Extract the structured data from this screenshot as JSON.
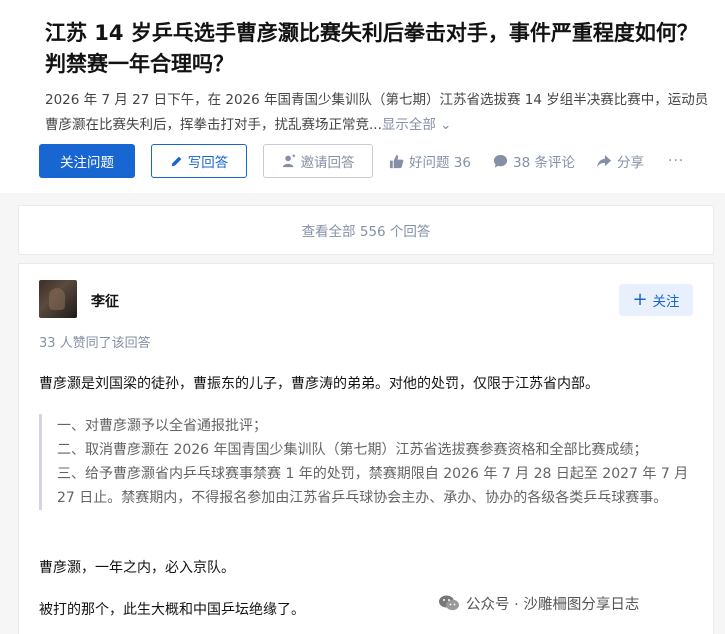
{
  "question": {
    "title": "江苏 14 岁乒乓选手曹彦灏比赛失利后拳击对手，事件严重程度如何？判禁赛一年合理吗？",
    "excerpt": "2026 年 7 月 27 日下午，在 2026 年国青国少集训队（第七期）江苏省选拔赛 14 岁组半决赛比赛中，运动员曹彦灏在比赛失利后，挥拳击打对手，扰乱赛场正常竞...",
    "show_all": "显示全部 ⌄"
  },
  "actions": {
    "follow_question": "关注问题",
    "write_answer": "写回答",
    "invite_answer": "邀请回答",
    "good_question": "好问题 36",
    "comments": "38 条评论",
    "share": "分享",
    "more": "···"
  },
  "view_all_answers": "查看全部 556 个回答",
  "answer": {
    "author": "李征",
    "follow_label": "关注",
    "voters": "33 人赞同了该回答",
    "paragraph1": "曹彦灏是刘国梁的徒孙，曹振东的儿子，曹彦涛的弟弟。对他的处罚，仅限于江苏省内部。",
    "quote_lines": [
      "一、对曹彦灏予以全省通报批评；",
      "二、取消曹彦灏在 2026 年国青国少集训队（第七期）江苏省选拔赛参赛资格和全部比赛成绩；",
      "三、给予曹彦灏省内乒乓球赛事禁赛 1 年的处罚，禁赛期限自 2026 年 7 月 28 日起至 2027 年 7 月 27 日止。禁赛期内，不得报名参加由江苏省乒乓球协会主办、承办、协办的各级各类乒乓球赛事。"
    ],
    "paragraph2": "曹彦灏，一年之内，必入京队。",
    "paragraph3": "被打的那个，此生大概和中国乒坛绝缘了。"
  },
  "watermark": "公众号 · 沙雕柵图分享日志",
  "colors": {
    "primary": "#1766d1",
    "muted": "#8590a6",
    "background": "#f6f6f6"
  }
}
